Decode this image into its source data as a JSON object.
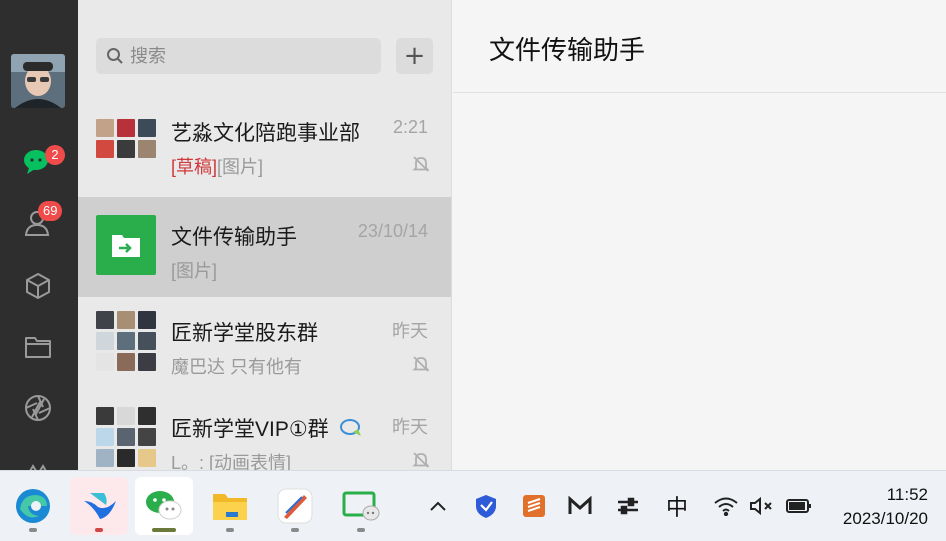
{
  "nav": {
    "chats_badge": "2",
    "contacts_badge": "69"
  },
  "search": {
    "placeholder": "搜索",
    "add_label": "+"
  },
  "chats": [
    {
      "name": "艺淼文化陪跑事业部",
      "time": "2:21",
      "draft": "[草稿]",
      "preview": "[图片]",
      "muted": true
    },
    {
      "name": "文件传输助手",
      "time": "23/10/14",
      "draft": "",
      "preview": "[图片]",
      "muted": false
    },
    {
      "name": "匠新学堂股东群",
      "time": "昨天",
      "draft": "",
      "preview": "魔巴达 只有他有",
      "muted": true
    },
    {
      "name": "匠新学堂VIP①群",
      "time": "昨天",
      "draft": "",
      "preview": "L。: [动画表情]",
      "muted": true
    }
  ],
  "main": {
    "title": "文件传输助手"
  },
  "taskbar": {
    "apps": [
      "edge-browser",
      "feishu",
      "wechat",
      "file-explorer",
      "pen-app",
      "wechat-screen"
    ],
    "tray_ime": "中",
    "time": "11:52",
    "date": "2023/10/20"
  },
  "colors": {
    "accent_green": "#07c160",
    "badge_red": "#f04b4b",
    "draft_red": "#d0383a",
    "file_helper_green": "#2aae4b"
  }
}
